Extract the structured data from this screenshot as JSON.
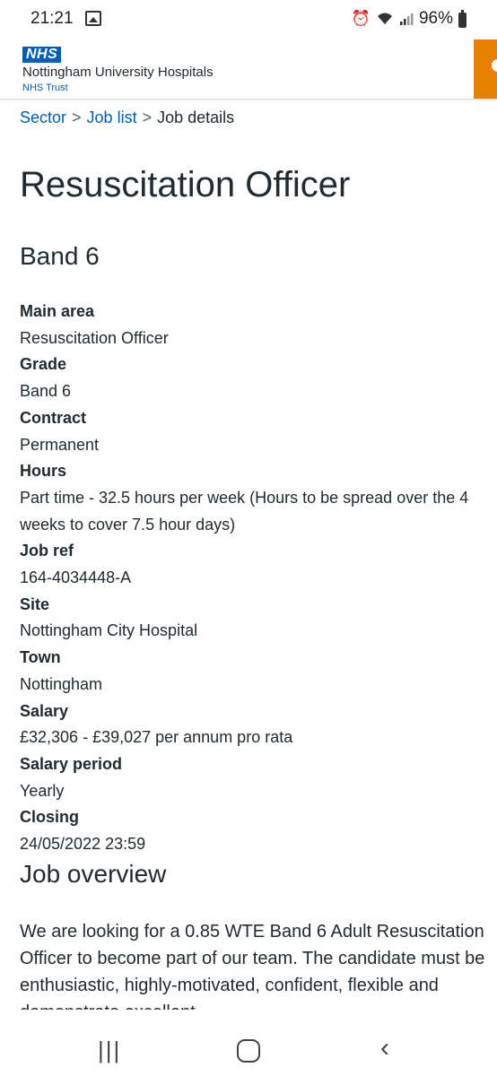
{
  "status_bar": {
    "time": "21:21",
    "battery": "96%"
  },
  "header": {
    "logo_text": "NHS",
    "org_name": "Nottingham University Hospitals",
    "org_sub": "NHS Trust"
  },
  "breadcrumb": {
    "items": [
      "Sector",
      "Job list",
      "Job details"
    ],
    "separator": ">"
  },
  "job": {
    "title": "Resuscitation Officer",
    "band": "Band 6",
    "details": [
      {
        "label": "Main area",
        "value": "Resuscitation Officer"
      },
      {
        "label": "Grade",
        "value": "Band 6"
      },
      {
        "label": "Contract",
        "value": "Permanent"
      },
      {
        "label": "Hours",
        "value": "Part time - 32.5 hours per week (Hours to be spread over the 4 weeks to cover 7.5 hour days)"
      },
      {
        "label": "Job ref",
        "value": "164-4034448-A"
      },
      {
        "label": "Site",
        "value": "Nottingham City Hospital"
      },
      {
        "label": "Town",
        "value": "Nottingham"
      },
      {
        "label": "Salary",
        "value": "£32,306 - £39,027 per annum pro rata"
      },
      {
        "label": "Salary period",
        "value": "Yearly"
      },
      {
        "label": "Closing",
        "value": "24/05/2022 23:59"
      }
    ]
  },
  "overview": {
    "heading": "Job overview",
    "text": "We are looking  for a 0.85 WTE Band 6 Adult Resuscitation Officer to become part of our team. The candidate must be enthusiastic, highly-motivated, confident, flexible and demonstrate excellent"
  },
  "colors": {
    "nhs_blue": "#005eb8",
    "accent_orange": "#e77f00",
    "text": "#212b32"
  }
}
